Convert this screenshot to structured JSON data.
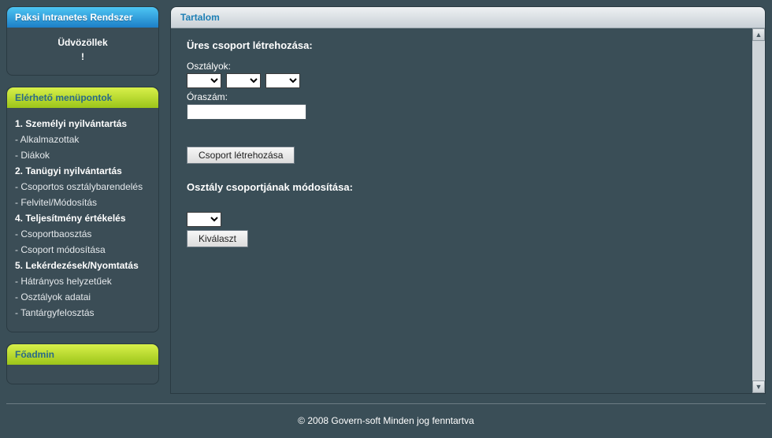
{
  "header": {
    "title": "Paksi Intranetes Rendszer",
    "welcome_line1": "Üdvözöllek",
    "welcome_line2": "!"
  },
  "menu": {
    "header": "Elérhető menüpontok",
    "items": [
      {
        "type": "heading",
        "label": "1. Személyi nyilvántartás"
      },
      {
        "type": "item",
        "label": "Alkalmazottak"
      },
      {
        "type": "item",
        "label": "Diákok"
      },
      {
        "type": "heading",
        "label": "2. Tanügyi nyilvántartás"
      },
      {
        "type": "item",
        "label": "Csoportos osztálybarendelés"
      },
      {
        "type": "item",
        "label": "Felvitel/Módosítás"
      },
      {
        "type": "heading",
        "label": "4. Teljesítmény értékelés"
      },
      {
        "type": "item",
        "label": "Csoportbaosztás"
      },
      {
        "type": "item",
        "label": "Csoport módosítása"
      },
      {
        "type": "heading",
        "label": "5. Lekérdezések/Nyomtatás"
      },
      {
        "type": "item",
        "label": "Hátrányos helyzetűek"
      },
      {
        "type": "item",
        "label": "Osztályok adatai"
      },
      {
        "type": "item",
        "label": "Tantárgyfelosztás"
      }
    ]
  },
  "admin_panel": {
    "header": "Főadmin"
  },
  "content": {
    "header": "Tartalom",
    "create_group": {
      "title": "Üres csoport létrehozása:",
      "classes_label": "Osztályok:",
      "hours_label": "Óraszám:",
      "hours_value": "",
      "submit_label": "Csoport létrehozása"
    },
    "modify_group": {
      "title": "Osztály csoportjának módosítása:",
      "select_label": "Kiválaszt"
    }
  },
  "footer": {
    "copyright": "© 2008 Govern-soft Minden jog fenntartva"
  }
}
